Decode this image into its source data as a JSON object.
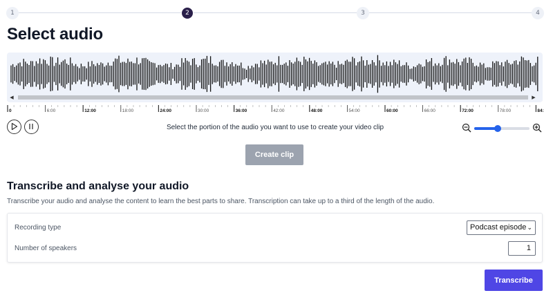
{
  "stepper": {
    "steps": [
      {
        "label": "1",
        "active": false
      },
      {
        "label": "2",
        "active": true
      },
      {
        "label": "3",
        "active": false
      },
      {
        "label": "4",
        "active": false
      }
    ]
  },
  "page_title": "Select audio",
  "timeline": {
    "ticks": [
      "0",
      "6:00",
      "12:00",
      "18:00",
      "24:00",
      "30:00",
      "36:00",
      "42:00",
      "48:00",
      "54:00",
      "60:00",
      "66:00",
      "72:00",
      "78:00",
      "84:"
    ]
  },
  "controls": {
    "play_icon": "play-icon",
    "pause_icon": "pause-icon",
    "instruction": "Select the portion of the audio you want to use to create your video clip",
    "zoom_out_icon": "zoom-out-icon",
    "zoom_in_icon": "zoom-in-icon",
    "zoom_level": 0.42
  },
  "create_clip_label": "Create clip",
  "transcribe_section": {
    "title": "Transcribe and analyse your audio",
    "description": "Transcribe your audio and analyse the content to learn the best parts to share. Transcription can take up to a third of the length of the audio.",
    "recording_type_label": "Recording type",
    "recording_type_value": "Podcast episode",
    "speakers_label": "Number of speakers",
    "speakers_value": "1"
  },
  "transcribe_button_label": "Transcribe",
  "colors": {
    "accent": "#4f46e5",
    "stepper_active": "#2a1f4a",
    "disabled_button": "#9ca3af",
    "slider": "#2563eb"
  }
}
